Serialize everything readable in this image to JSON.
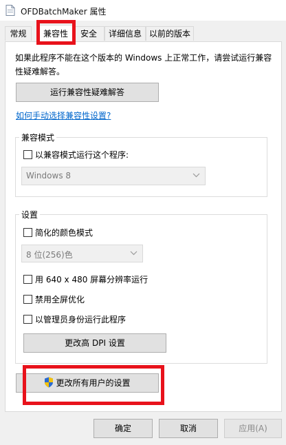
{
  "window": {
    "title": "OFDBatchMaker 属性"
  },
  "tabs": [
    "常规",
    "兼容性",
    "安全",
    "详细信息",
    "以前的版本"
  ],
  "intro": "如果此程序不能在这个版本的 Windows 上正常工作，请尝试运行兼容性疑难解答。",
  "troubleshoot_button": "运行兼容性疑难解答",
  "manual_link": "如何手动选择兼容性设置?",
  "compat_mode": {
    "legend": "兼容模式",
    "checkbox": "以兼容模式运行这个程序:",
    "select_value": "Windows 8"
  },
  "settings": {
    "legend": "设置",
    "reduced_color": "简化的颜色模式",
    "color_select_value": "8 位(256)色",
    "res_640": "用 640 x 480 屏幕分辨率运行",
    "disable_fullscreen": "禁用全屏优化",
    "run_as_admin": "以管理员身份运行此程序",
    "dpi_button": "更改高 DPI 设置"
  },
  "all_users_button": "更改所有用户的设置",
  "footer": {
    "ok": "确定",
    "cancel": "取消",
    "apply": "应用(A)"
  },
  "colors": {
    "link": "#0066cc",
    "highlight": "#e8121b",
    "button_bg": "#e1e1e1",
    "disabled_text": "#7a7a7a"
  }
}
